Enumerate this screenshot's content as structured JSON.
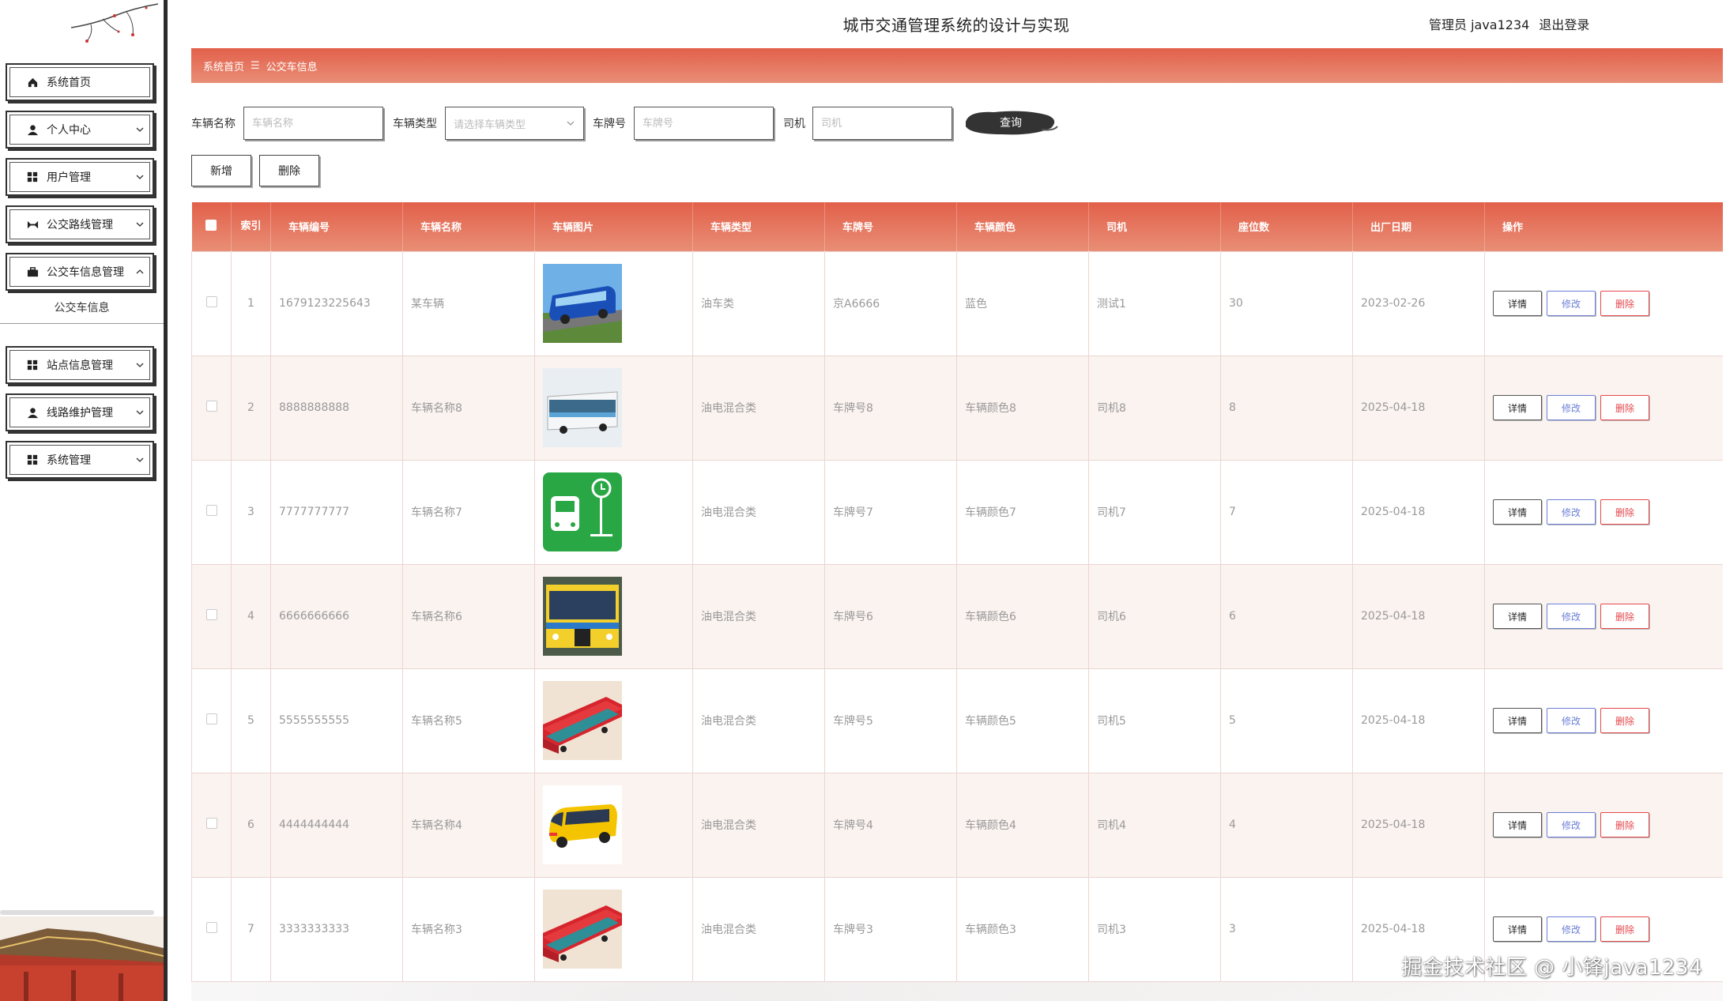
{
  "header": {
    "app_title": "城市交通管理系统的设计与实现",
    "user_label": "管理员 java1234",
    "logout_label": "退出登录"
  },
  "sidebar": {
    "items": [
      {
        "label": "系统首页",
        "icon": "home-icon",
        "expandable": false
      },
      {
        "label": "个人中心",
        "icon": "user-icon",
        "expandable": true
      },
      {
        "label": "用户管理",
        "icon": "grid-icon",
        "expandable": true
      },
      {
        "label": "公交路线管理",
        "icon": "route-icon",
        "expandable": true
      },
      {
        "label": "公交车信息管理",
        "icon": "briefcase-icon",
        "expandable": true,
        "expanded": true
      },
      {
        "label": "站点信息管理",
        "icon": "grid-icon",
        "expandable": true
      },
      {
        "label": "线路维护管理",
        "icon": "user-icon",
        "expandable": true
      },
      {
        "label": "系统管理",
        "icon": "grid-icon",
        "expandable": true
      }
    ],
    "submenu_label": "公交车信息"
  },
  "breadcrumb": {
    "home": "系统首页",
    "separator": "☰",
    "current": "公交车信息"
  },
  "search": {
    "vehicle_name_label": "车辆名称",
    "vehicle_name_placeholder": "车辆名称",
    "vehicle_type_label": "车辆类型",
    "vehicle_type_placeholder": "请选择车辆类型",
    "plate_label": "车牌号",
    "plate_placeholder": "车牌号",
    "driver_label": "司机",
    "driver_placeholder": "司机",
    "query_label": "查询"
  },
  "toolbar": {
    "add_label": "新增",
    "delete_label": "删除"
  },
  "table": {
    "columns": [
      "",
      "索引",
      "车辆编号",
      "车辆名称",
      "车辆图片",
      "车辆类型",
      "车牌号",
      "车辆颜色",
      "司机",
      "座位数",
      "出厂日期",
      "操作"
    ],
    "rows": [
      {
        "index": "1",
        "code": "1679123225643",
        "name": "某车辆",
        "image": "bus-blue-coach",
        "type": "油车类",
        "plate": "京A6666",
        "color": "蓝色",
        "driver": "测试1",
        "seats": "30",
        "date": "2023-02-26"
      },
      {
        "index": "2",
        "code": "8888888888",
        "name": "车辆名称8",
        "image": "bus-white-electric",
        "type": "油电混合类",
        "plate": "车牌号8",
        "color": "车辆颜色8",
        "driver": "司机8",
        "seats": "8",
        "date": "2025-04-18"
      },
      {
        "index": "3",
        "code": "7777777777",
        "name": "车辆名称7",
        "image": "bus-stop-green-icon",
        "type": "油电混合类",
        "plate": "车牌号7",
        "color": "车辆颜色7",
        "driver": "司机7",
        "seats": "7",
        "date": "2025-04-18"
      },
      {
        "index": "4",
        "code": "6666666666",
        "name": "车辆名称6",
        "image": "bus-yellow-city",
        "type": "油电混合类",
        "plate": "车牌号6",
        "color": "车辆颜色6",
        "driver": "司机6",
        "seats": "6",
        "date": "2025-04-18"
      },
      {
        "index": "5",
        "code": "5555555555",
        "name": "车辆名称5",
        "image": "bus-red-isometric",
        "type": "油电混合类",
        "plate": "车牌号5",
        "color": "车辆颜色5",
        "driver": "司机5",
        "seats": "5",
        "date": "2025-04-18"
      },
      {
        "index": "6",
        "code": "4444444444",
        "name": "车辆名称4",
        "image": "bus-yellow-toy",
        "type": "油电混合类",
        "plate": "车牌号4",
        "color": "车辆颜色4",
        "driver": "司机4",
        "seats": "4",
        "date": "2025-04-18"
      },
      {
        "index": "7",
        "code": "3333333333",
        "name": "车辆名称3",
        "image": "bus-red-isometric",
        "type": "油电混合类",
        "plate": "车牌号3",
        "color": "车辆颜色3",
        "driver": "司机3",
        "seats": "3",
        "date": "2025-04-18"
      }
    ],
    "ops": {
      "detail": "详情",
      "edit": "修改",
      "delete": "删除"
    }
  },
  "watermark": "掘金技术社区 @ 小锋java1234",
  "colors": {
    "accent": "#e2604a",
    "accent_light": "#e98e76",
    "edit": "#6b7fd7",
    "delete": "#e5484d"
  }
}
